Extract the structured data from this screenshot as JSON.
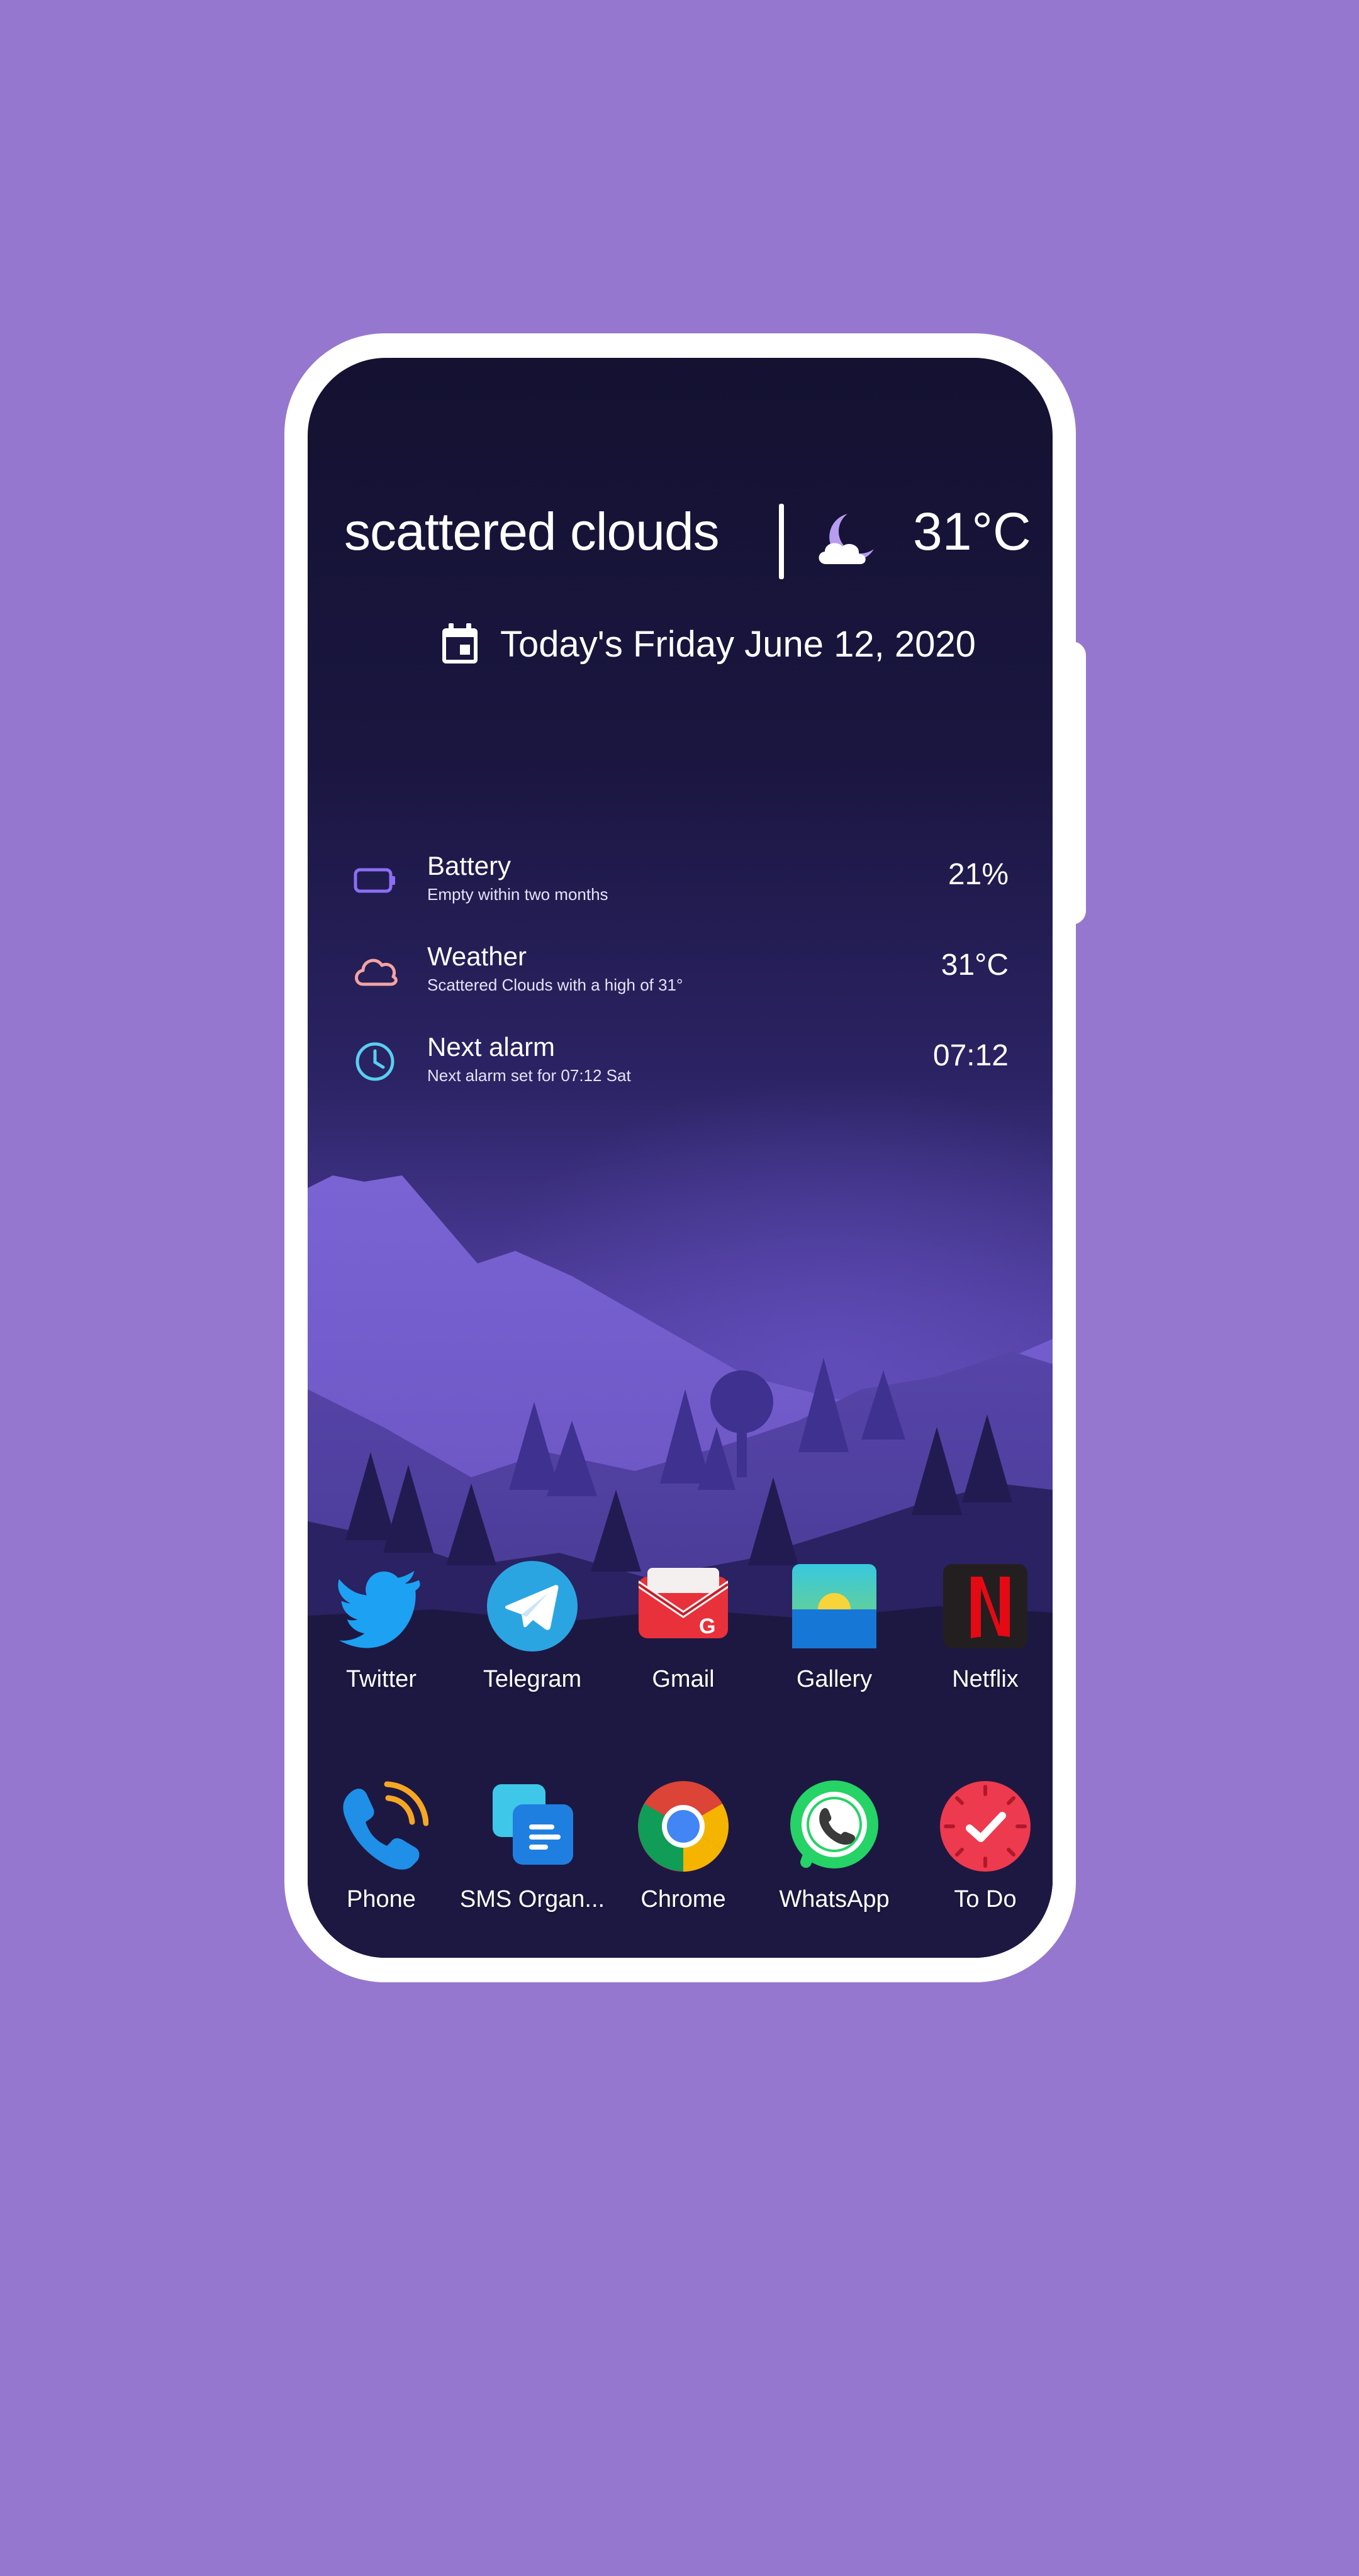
{
  "weather": {
    "condition": "scattered clouds",
    "temperature": "31°C",
    "icon": "moon-cloud-icon"
  },
  "date_line": "Today's Friday June 12, 2020",
  "info_list": [
    {
      "title": "Battery",
      "subtitle": "Empty within two months",
      "value": "21%",
      "icon": "battery-icon",
      "color": "#8b6ef5"
    },
    {
      "title": "Weather",
      "subtitle": "Scattered Clouds with a high of 31°",
      "value": "31°C",
      "icon": "cloud-icon",
      "color": "#f4a3a3"
    },
    {
      "title": "Next alarm",
      "subtitle": "Next alarm set for 07:12 Sat",
      "value": "07:12",
      "icon": "clock-icon",
      "color": "#58d0f0"
    }
  ],
  "apps_row1": [
    {
      "label": "Twitter",
      "icon": "twitter-icon"
    },
    {
      "label": "Telegram",
      "icon": "telegram-icon"
    },
    {
      "label": "Gmail",
      "icon": "gmail-icon"
    },
    {
      "label": "Gallery",
      "icon": "gallery-icon"
    },
    {
      "label": "Netflix",
      "icon": "netflix-icon"
    }
  ],
  "apps_row2": [
    {
      "label": "Phone",
      "icon": "phone-icon"
    },
    {
      "label": "SMS Organ...",
      "icon": "sms-organizer-icon"
    },
    {
      "label": "Chrome",
      "icon": "chrome-icon"
    },
    {
      "label": "WhatsApp",
      "icon": "whatsapp-icon"
    },
    {
      "label": "To Do",
      "icon": "todo-icon"
    }
  ],
  "colors": {
    "background": "#9677cf",
    "frame": "#ffffff",
    "screen_top": "#141131",
    "mountain_light": "#6b55c8",
    "mountain_dark": "#1f1a45"
  }
}
